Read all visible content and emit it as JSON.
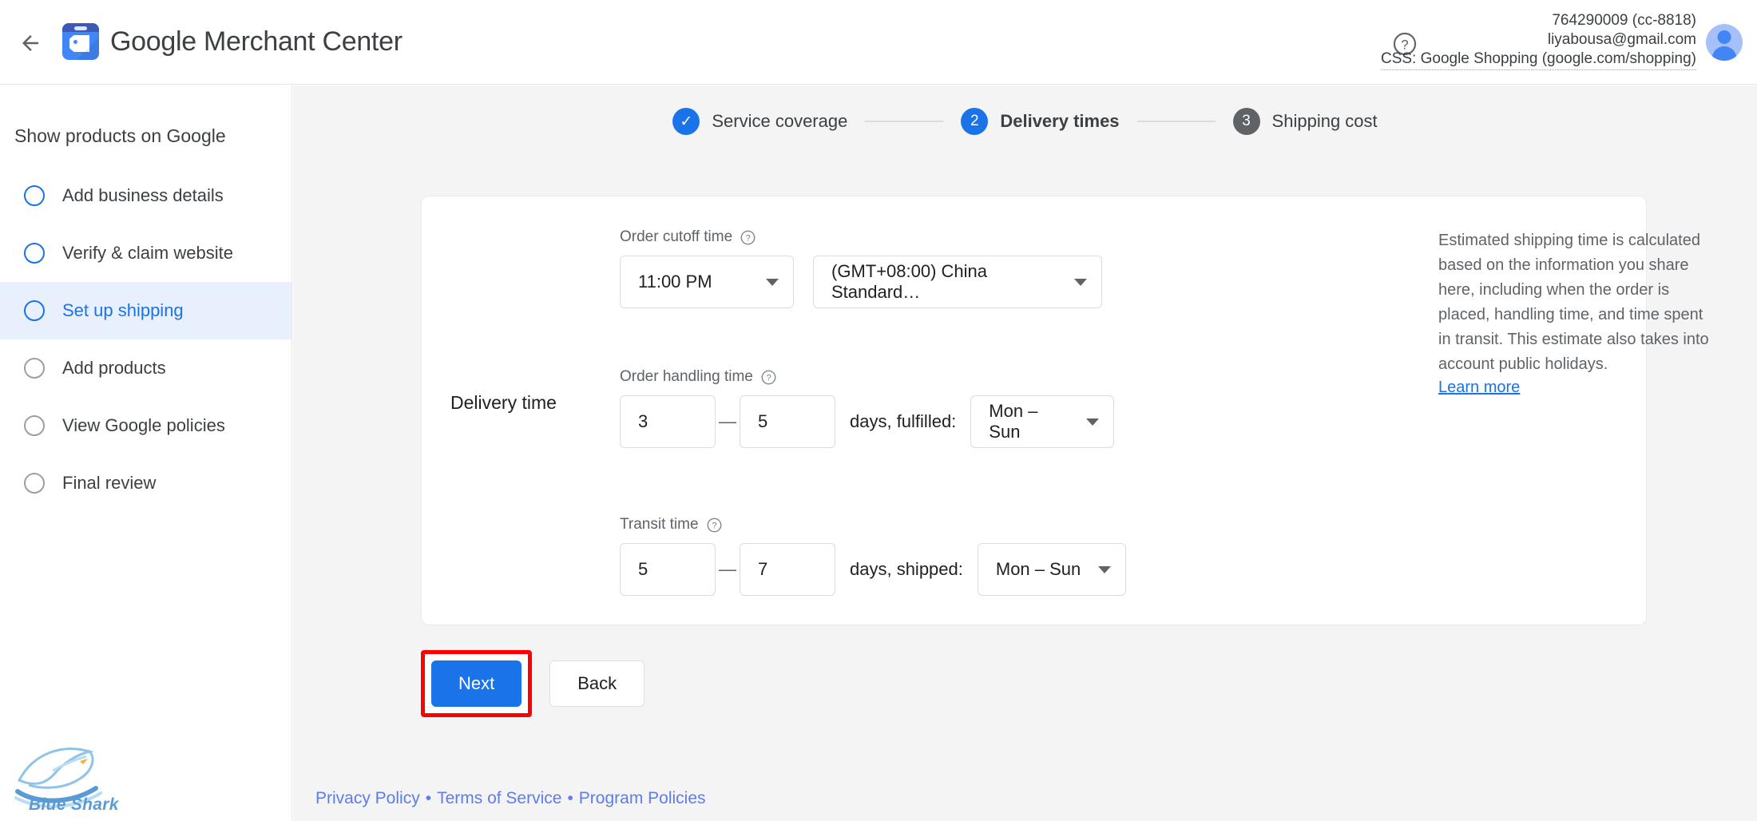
{
  "topbar": {
    "back_icon": "back-arrow-icon",
    "logo_icon": "merchant-center-logo-icon",
    "brand_google": "Google",
    "brand_product": " Merchant Center",
    "help_icon": "help-question-icon",
    "account_id": "764290009 (cc-8818)",
    "account_email": "liyabousa@gmail.com",
    "account_css": "CSS: Google Shopping (google.com/shopping)",
    "avatar_icon": "user-avatar-icon"
  },
  "sidebar": {
    "title": "Show products on Google",
    "items": [
      {
        "label": "Add business details",
        "state": "blue",
        "active": false
      },
      {
        "label": "Verify & claim website",
        "state": "blue",
        "active": false
      },
      {
        "label": "Set up shipping",
        "state": "blue",
        "active": true
      },
      {
        "label": "Add products",
        "state": "gray",
        "active": false
      },
      {
        "label": "View Google policies",
        "state": "gray",
        "active": false
      },
      {
        "label": "Final review",
        "state": "gray",
        "active": false
      }
    ],
    "brand_logo_name": "Blue Shark"
  },
  "stepper": {
    "steps": [
      {
        "badge": "✓",
        "label": "Service coverage",
        "state": "done"
      },
      {
        "badge": "2",
        "label": "Delivery times",
        "state": "current"
      },
      {
        "badge": "3",
        "label": "Shipping cost",
        "state": "upcoming"
      }
    ]
  },
  "form": {
    "row_label": "Delivery time",
    "cutoff": {
      "label": "Order cutoff time",
      "help_icon": "help-question-icon",
      "time_value": "11:00 PM",
      "timezone_value": "(GMT+08:00) China Standard…"
    },
    "handling": {
      "label": "Order handling time",
      "help_icon": "help-question-icon",
      "min": "3",
      "dash": "—",
      "max": "5",
      "unit_text": "days, fulfilled:",
      "days_value": "Mon – Sun"
    },
    "transit": {
      "label": "Transit time",
      "help_icon": "help-question-icon",
      "min": "5",
      "dash": "—",
      "max": "7",
      "unit_text": "days, shipped:",
      "days_value": "Mon – Sun"
    }
  },
  "info": {
    "text": "Estimated shipping time is calculated based on the information you share here, including when the order is placed, handling time, and time spent in transit. This estimate also takes into account public holidays.",
    "link": "Learn more"
  },
  "actions": {
    "next": "Next",
    "back": "Back",
    "highlight_color": "#ff0000"
  },
  "footer": {
    "links": [
      "Privacy Policy",
      "Terms of Service",
      "Program Policies"
    ],
    "separator": "•"
  },
  "colors": {
    "accent_blue": "#1a73e8",
    "active_nav_bg": "#e8f0fe",
    "page_bg": "#f4f4f4",
    "muted_text": "#5f6368",
    "footer_link": "#5c7cf0"
  }
}
